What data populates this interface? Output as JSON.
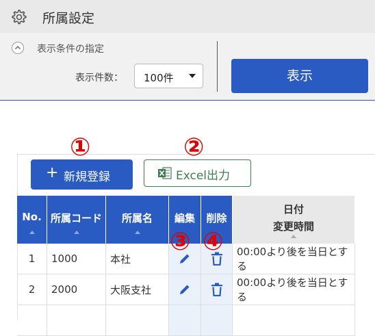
{
  "header": {
    "title": "所属設定",
    "icon": "gear-icon"
  },
  "conditions": {
    "label": "表示条件の指定",
    "count_label": "表示件数：",
    "count_value": "100件",
    "show_button": "表示"
  },
  "actions": {
    "new_button": "新規登録",
    "new_icon": "+",
    "excel_button": "Excel出力",
    "annotations": [
      "①",
      "②",
      "③",
      "④"
    ]
  },
  "table": {
    "columns": [
      "No.",
      "所属コード",
      "所属名",
      "編集",
      "削除",
      "日付",
      "変更時間"
    ],
    "rows": [
      {
        "no": "1",
        "code": "1000",
        "name": "本社",
        "time": "00:00より後を当日とする"
      },
      {
        "no": "2",
        "code": "2000",
        "name": "大阪支社",
        "time": "00:00より後を当日とする"
      }
    ]
  },
  "colors": {
    "primary": "#2a5bc3",
    "excel": "#3f7c54",
    "annotation": "#e00000"
  }
}
